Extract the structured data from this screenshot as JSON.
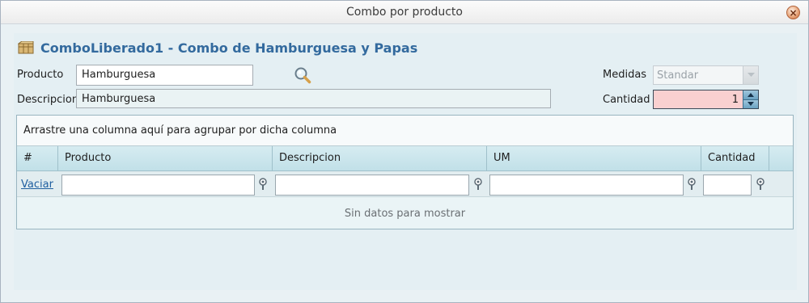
{
  "window": {
    "title": "Combo por producto",
    "close_icon": "close-icon"
  },
  "header": {
    "title": "ComboLiberado1 - Combo de Hamburguesa y Papas",
    "icon": "box-icon"
  },
  "form": {
    "producto_label": "Producto",
    "producto_value": "Hamburguesa",
    "descripcion_label": "Descripcion",
    "descripcion_value": "Hamburguesa",
    "medidas_label": "Medidas",
    "medidas_value": "Standar",
    "cantidad_label": "Cantidad",
    "cantidad_value": "1",
    "search_icon": "magnifier-icon"
  },
  "grid": {
    "group_panel_text": "Arrastre una columna aquí para agrupar por dicha columna",
    "columns": [
      "#",
      "Producto",
      "Descripcion",
      "UM",
      "Cantidad"
    ],
    "filter_clear_label": "Vaciar",
    "empty_text": "Sin datos para mostrar"
  },
  "colors": {
    "accent_title": "#336a9e",
    "cantidad_bg": "#f9d0d0",
    "header_bg": "#c1e0e8"
  }
}
